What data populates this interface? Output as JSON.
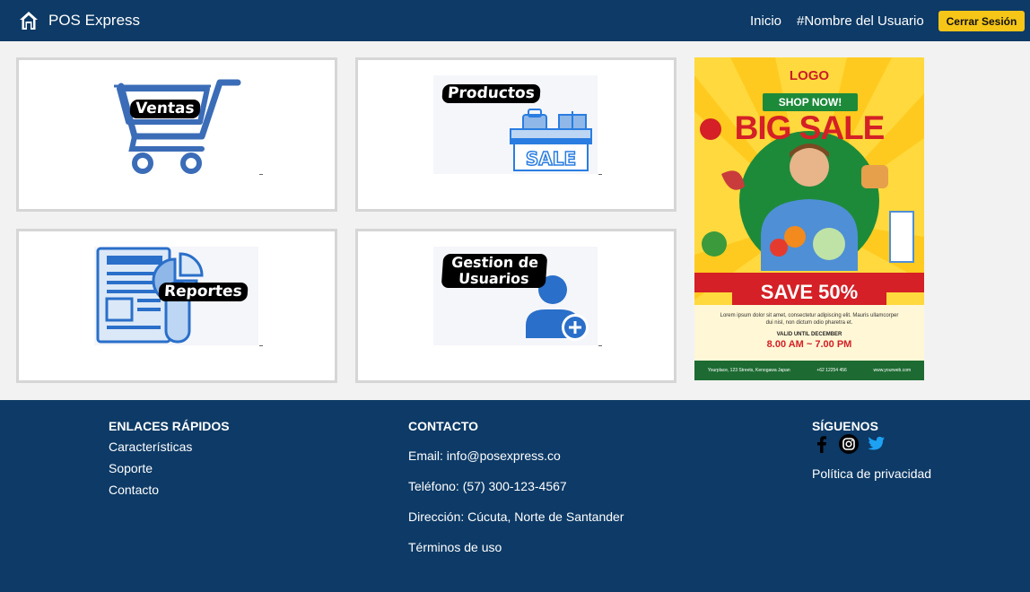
{
  "navbar": {
    "brand": "POS Express",
    "links": [
      "Inicio",
      "#Nombre del Usuario"
    ],
    "logout_label": "Cerrar Sesión"
  },
  "cards": [
    {
      "id": "ventas",
      "label": "Ventas",
      "icon": "shopping-cart-icon"
    },
    {
      "id": "productos",
      "label": "Productos",
      "icon": "sale-products-icon"
    },
    {
      "id": "reportes",
      "label": "Reportes",
      "icon": "report-document-icon"
    },
    {
      "id": "usuarios",
      "label": "Gestion de Usuarios",
      "icon": "add-user-icon"
    }
  ],
  "ad": {
    "logo": "LOGO",
    "shop_now": "SHOP NOW!",
    "headline": "BIG SALE",
    "discount": "SAVE 50%",
    "lorem": "Lorem ipsum dolor sit amet, consectetur adipiscing elit. Mauris ullamcorper dui nisl, non dictum odio pharetra et.",
    "valid": "VALID UNTIL DECEMBER",
    "hours": "8.00 AM ~ 7.00 PM",
    "address": "Yourplace, 123 Streets, Kenogawa Japan",
    "phone": "+62 12254 456",
    "web": "www.yourweb.com"
  },
  "footer": {
    "quick_links": {
      "heading": "ENLACES RÁPIDOS",
      "items": [
        "Características",
        "Soporte",
        "Contacto"
      ]
    },
    "contact": {
      "heading": "CONTACTO",
      "email": "Email: info@posexpress.co",
      "phone": "Teléfono: (57) 300-123-4567",
      "address": "Dirección: Cúcuta, Norte de Santander",
      "terms": "Términos de uso"
    },
    "follow": {
      "heading": "SÍGUENOS",
      "icons": [
        "facebook-icon",
        "instagram-icon",
        "twitter-icon"
      ],
      "privacy": "Política de privacidad"
    }
  },
  "colors": {
    "navy": "#0d3a66",
    "accent": "#f5c518",
    "background": "#f2f2f2",
    "icon_blue": "#3b6cb7"
  }
}
